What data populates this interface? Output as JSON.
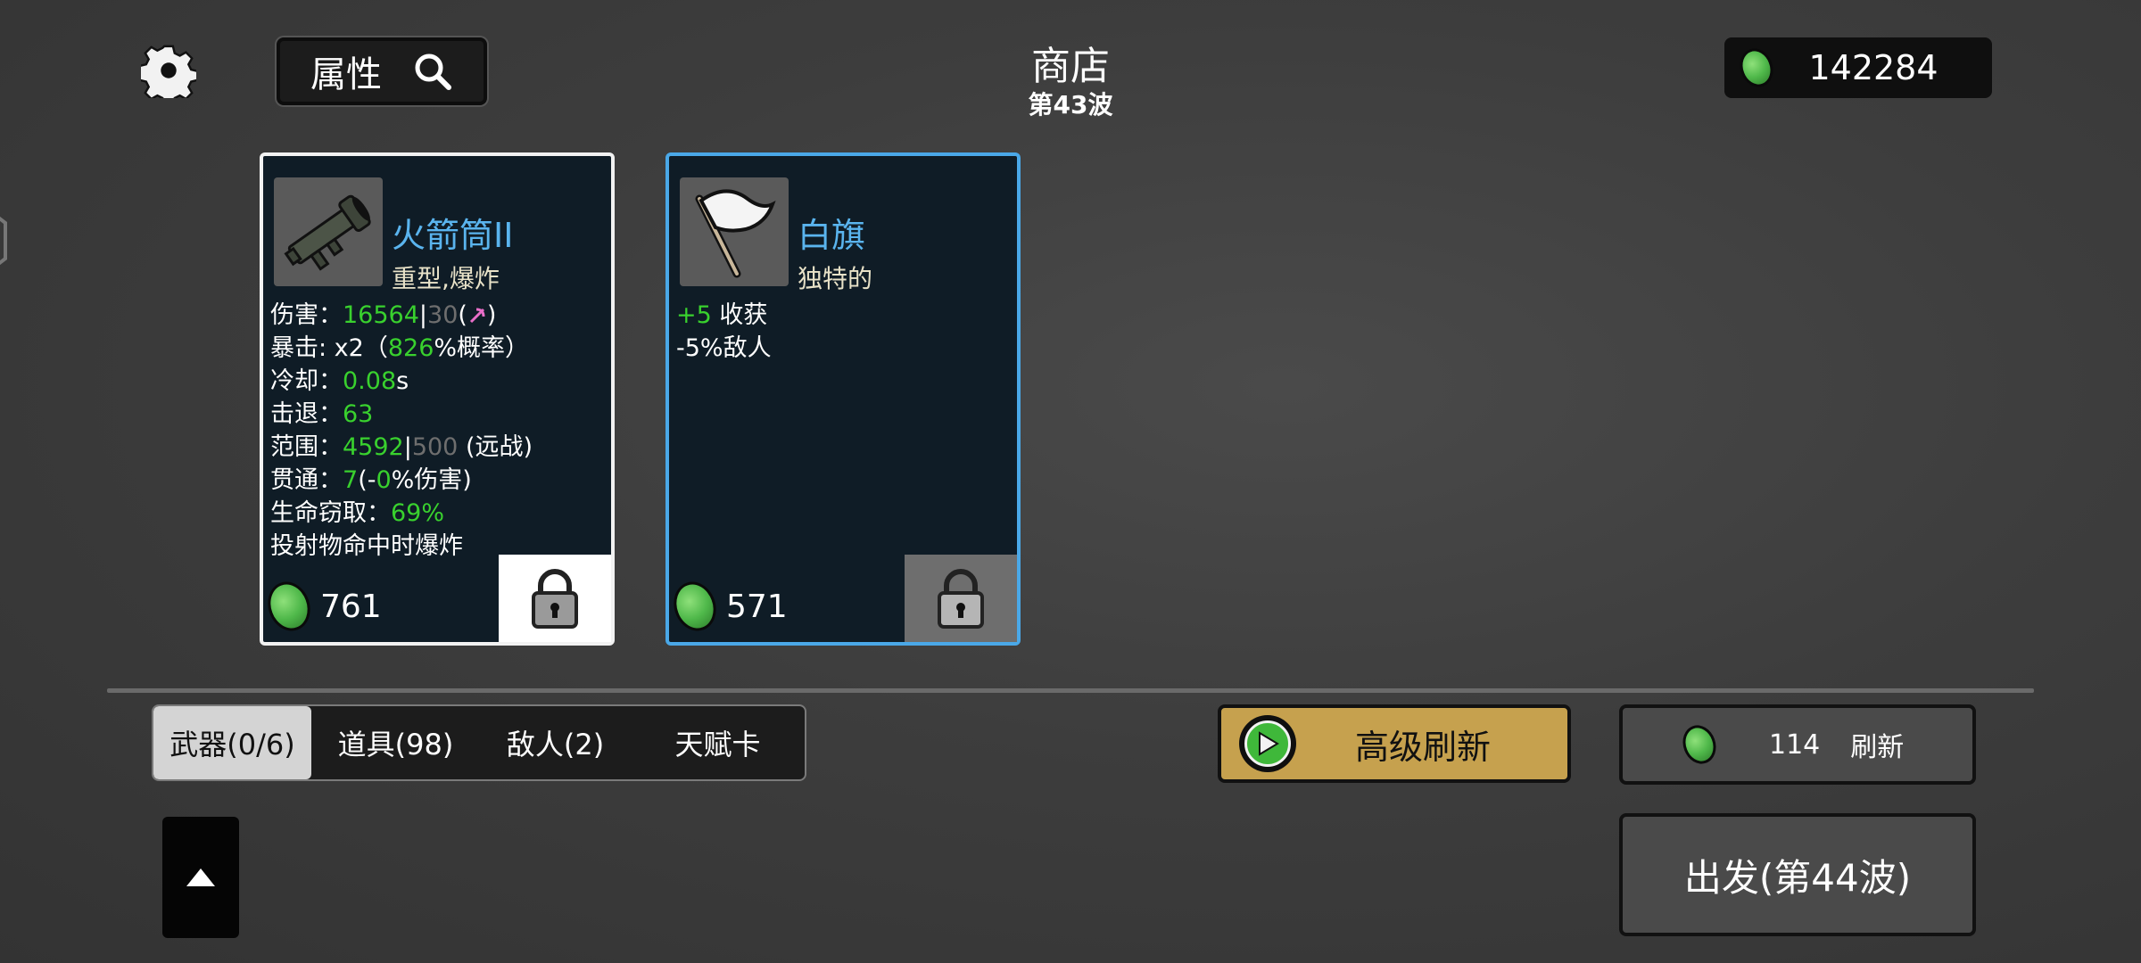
{
  "header": {
    "title": "商店",
    "wave": "第43波",
    "attributes_label": "属性",
    "gold": "142284"
  },
  "cards": [
    {
      "name": "火箭筒II",
      "tags": "重型,爆炸",
      "price": "761",
      "icon": "rocket-launcher-icon",
      "stats": {
        "damage_label": "伤害：",
        "damage_value": "16564",
        "damage_sep": "|",
        "damage_base": "30",
        "damage_paren_open": "(",
        "damage_paren_close": ")",
        "crit_label": "暴击:  x2（",
        "crit_value": "826",
        "crit_suffix": "%概率）",
        "cooldown_label": "冷却：",
        "cooldown_value": "0.08",
        "cooldown_unit": "s",
        "knockback_label": "击退：",
        "knockback_value": "63",
        "range_label": "范围：",
        "range_value": "4592",
        "range_sep": "|",
        "range_base": "500",
        "range_suffix": " (远战)",
        "pierce_label": "贯通：",
        "pierce_value": "7",
        "pierce_mid": "(-",
        "pierce_pct": "0",
        "pierce_suffix": "%伤害)",
        "lifesteal_label": "生命窃取：",
        "lifesteal_value": "69%",
        "effect": "投射物命中时爆炸"
      }
    },
    {
      "name": "白旗",
      "tags": "独特的",
      "price": "571",
      "icon": "white-flag-icon",
      "stats": {
        "harvest_value": "+5",
        "harvest_label": " 收获",
        "enemies_line": "-5%敌人"
      }
    }
  ],
  "tabs": [
    {
      "label": "武器(0/6)",
      "active": true
    },
    {
      "label": "道具(98)",
      "active": false
    },
    {
      "label": "敌人(2)",
      "active": false
    },
    {
      "label": "天赋卡",
      "active": false
    }
  ],
  "buttons": {
    "advanced_refresh": "高级刷新",
    "refresh_cost": "114",
    "refresh_label": "刷新",
    "depart": "出发(第44波)"
  },
  "colors": {
    "accent_blue": "#5ab4ee",
    "stat_green": "#39d12e",
    "gold_button": "#c6a14e",
    "card_bg": "#0f1c26"
  }
}
